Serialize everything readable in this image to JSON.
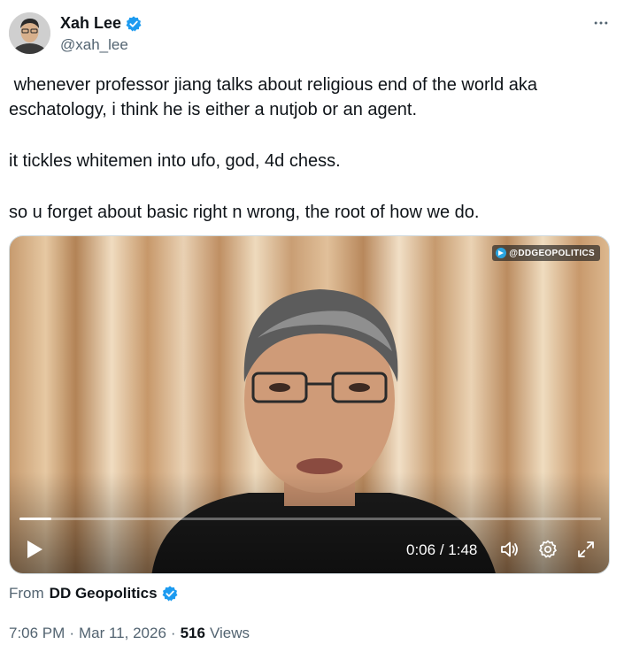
{
  "author": {
    "display_name": "Xah Lee",
    "handle": "@xah_lee",
    "avatar": "avatar-icon",
    "verified_icon": "verified-badge-icon"
  },
  "more_menu": "more-options-icon",
  "tweet": {
    "lines": [
      " whenever professor jiang talks about religious end of the world aka eschatology, i think he is either a nutjob or an agent.",
      "it tickles whitemen into ufo, god, 4d chess.",
      "so u forget about basic right n wrong, the root of how we do."
    ]
  },
  "video": {
    "watermark": "@DDGEOPOLITICS",
    "current_time": "0:06",
    "separator": " / ",
    "duration": "1:48",
    "progress_fraction": 0.055,
    "controls": [
      "play-icon",
      "volume-icon",
      "settings-icon",
      "fullscreen-icon"
    ]
  },
  "source": {
    "prefix": "From",
    "name": "DD Geopolitics"
  },
  "meta": {
    "time": "7:06 PM",
    "date": "Mar 11, 2026",
    "views_count": "516",
    "views_label": "Views",
    "separator": "·"
  },
  "colors": {
    "text_primary": "#0f1419",
    "text_secondary": "#536471",
    "verified_blue": "#1d9bf0"
  }
}
